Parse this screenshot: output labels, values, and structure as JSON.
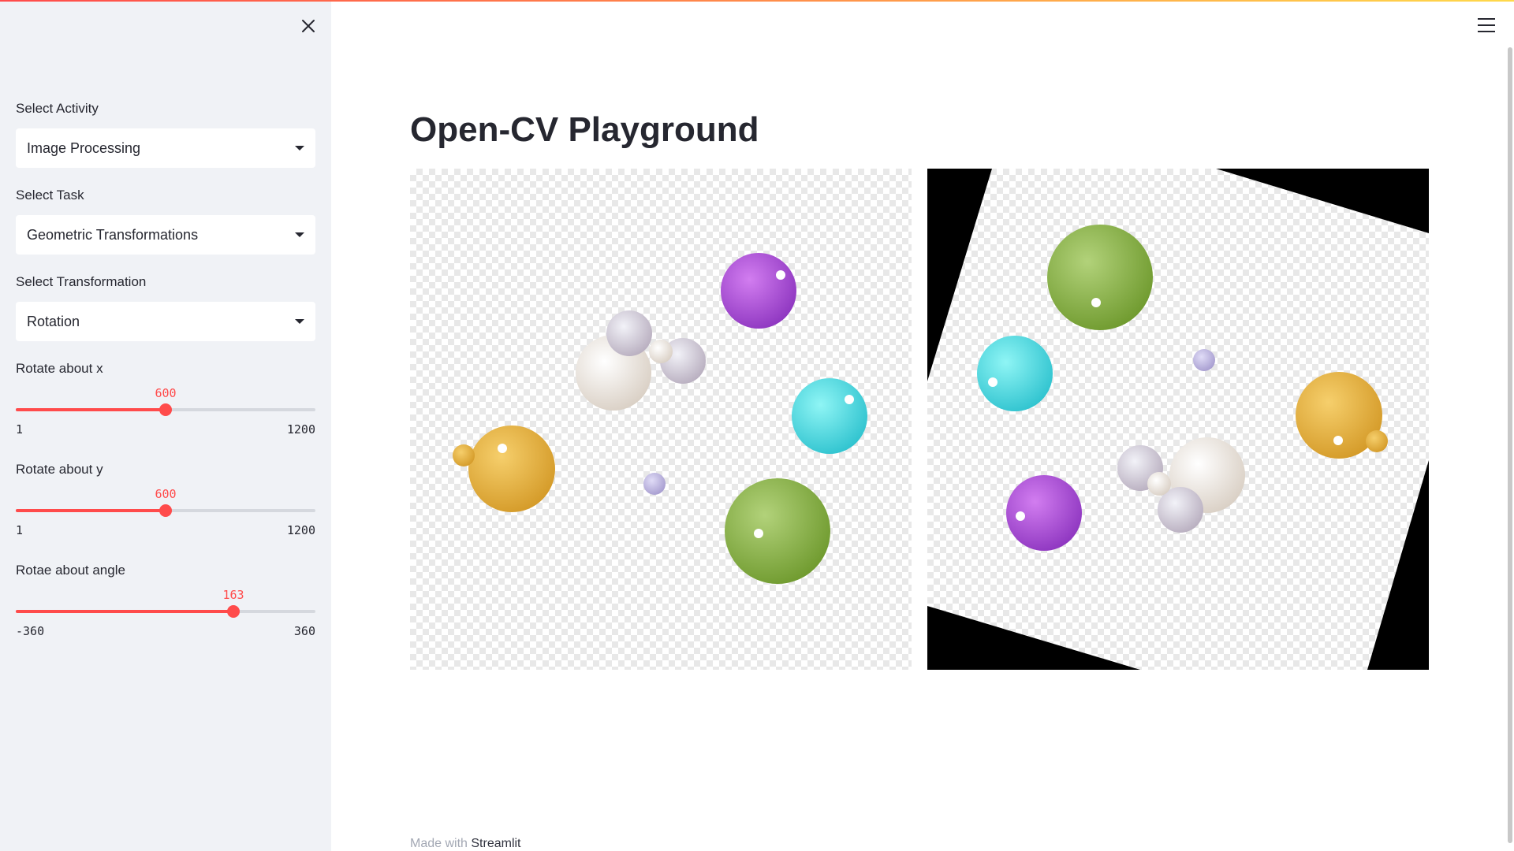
{
  "sidebar": {
    "activity": {
      "label": "Select Activity",
      "value": "Image Processing"
    },
    "task": {
      "label": "Select Task",
      "value": "Geometric Transformations"
    },
    "transformation": {
      "label": "Select Transformation",
      "value": "Rotation"
    },
    "sliders": [
      {
        "label": "Rotate about x",
        "value": "600",
        "min": "1",
        "max": "1200",
        "fraction": 0.5
      },
      {
        "label": "Rotate about y",
        "value": "600",
        "min": "1",
        "max": "1200",
        "fraction": 0.5
      },
      {
        "label": "Rotae about angle",
        "value": "163",
        "min": "-360",
        "max": "360",
        "fraction": 0.726
      }
    ]
  },
  "main": {
    "title": "Open-CV Playground",
    "rotation_angle": 163
  },
  "footer": {
    "prefix": "Made with ",
    "brand": "Streamlit"
  },
  "colors": {
    "accent": "#ff4b4b",
    "sidebar_bg": "#f0f2f6"
  },
  "icons": {
    "close": "close-icon",
    "menu": "hamburger-menu-icon"
  }
}
